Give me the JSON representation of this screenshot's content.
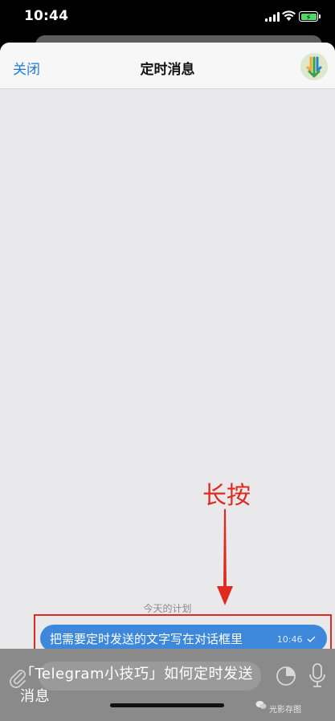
{
  "status_bar": {
    "time": "10:44"
  },
  "nav": {
    "close_label": "关闭",
    "title": "定时消息"
  },
  "chat": {
    "date_header": "今天的计划",
    "message": {
      "text": "把需要定时发送的文字写在对话框里",
      "time": "10:46",
      "status_icon": "check-icon"
    }
  },
  "annotation": {
    "label": "长按",
    "color": "#e02a1f"
  },
  "caption": {
    "text": "「Telegram小技巧」如何定时发送消息"
  },
  "watermark": {
    "text": "光影存图"
  },
  "colors": {
    "accent": "#1c7ad6",
    "bubble": "#3d88da",
    "battery": "#4cd964"
  }
}
